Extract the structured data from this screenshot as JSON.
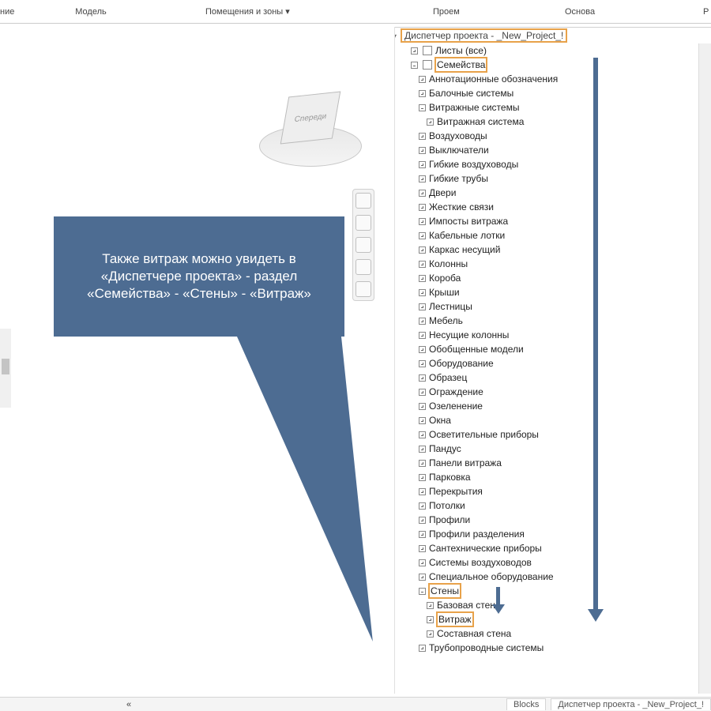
{
  "ribbon": {
    "r0": "ние",
    "r1": "Модель",
    "r2": "Помещения и зоны ▾",
    "r3": "Проем",
    "r4": "Основа",
    "r5": "Р"
  },
  "cube": {
    "front": "Спереди"
  },
  "callout": "Также витраж можно увидеть в «Диспетчере проекта» - раздел «Семейства» - «Стены» - «Витраж»",
  "browser": {
    "title": "Диспетчер проекта - _New_Project_!",
    "top": [
      {
        "exp": "plus",
        "icon": true,
        "label": "Листы (все)"
      },
      {
        "exp": "minus",
        "icon": true,
        "label": "Семейства",
        "hl": true
      }
    ],
    "families": [
      "Аннотационные обозначения",
      "Балочные системы"
    ],
    "vitrazh_group": {
      "parent": "Витражные системы",
      "child": "Витражная система"
    },
    "families2": [
      "Воздуховоды",
      "Выключатели",
      "Гибкие воздуховоды",
      "Гибкие трубы",
      "Двери",
      "Жесткие связи",
      "Импосты витража",
      "Кабельные лотки",
      "Каркас несущий",
      "Колонны",
      "Короба",
      "Крыши",
      "Лестницы",
      "Мебель",
      "Несущие колонны",
      "Обобщенные модели",
      "Оборудование",
      "Образец",
      "Ограждение",
      "Озеленение",
      "Окна",
      "Осветительные приборы",
      "Пандус",
      "Панели витража",
      "Парковка",
      "Перекрытия",
      "Потолки",
      "Профили",
      "Профили разделения",
      "Сантехнические приборы",
      "Системы воздуховодов",
      "Специальное оборудование"
    ],
    "walls": {
      "label": "Стены",
      "children": [
        "Базовая стена",
        "Витраж",
        "Составная стена"
      ],
      "hl_child_index": 1
    },
    "last": "Трубопроводные системы"
  },
  "status": {
    "chev": "«",
    "tab1": "Blocks",
    "tab2": "Диспетчер проекта - _New_Project_!"
  }
}
